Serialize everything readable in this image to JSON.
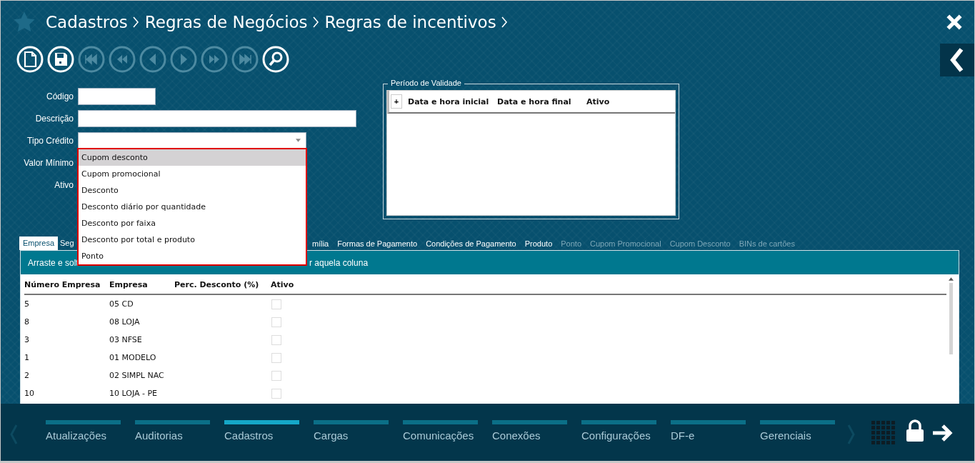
{
  "breadcrumb": [
    "Cadastros",
    "Regras de Negócios",
    "Regras de incentivos"
  ],
  "toolbar": [
    {
      "kind": "new",
      "disabled": false
    },
    {
      "kind": "save",
      "disabled": false
    },
    {
      "kind": "first",
      "disabled": true
    },
    {
      "kind": "rewind",
      "disabled": true
    },
    {
      "kind": "prev",
      "disabled": true
    },
    {
      "kind": "next",
      "disabled": true
    },
    {
      "kind": "forward",
      "disabled": true
    },
    {
      "kind": "last",
      "disabled": true
    },
    {
      "kind": "search",
      "disabled": false
    }
  ],
  "form": {
    "fields": [
      {
        "label": "Código",
        "kind": "text"
      },
      {
        "label": "Descrição",
        "kind": "text"
      },
      {
        "label": "Tipo Crédito",
        "kind": "select"
      },
      {
        "label": "Valor Mínimo",
        "kind": "covered"
      },
      {
        "label": "Ativo",
        "kind": "covered"
      }
    ]
  },
  "dropdown": {
    "options": [
      {
        "label": "Cupom desconto",
        "selected": true
      },
      {
        "label": "Cupom promocional",
        "selected": false
      },
      {
        "label": "Desconto",
        "selected": false
      },
      {
        "label": "Desconto diário por quantidade",
        "selected": false
      },
      {
        "label": "Desconto por faixa",
        "selected": false
      },
      {
        "label": "Desconto por total e produto",
        "selected": false
      },
      {
        "label": "Ponto",
        "selected": false
      }
    ]
  },
  "validity": {
    "legend": "Período de Validade",
    "add_button": "+",
    "columns": [
      "Data e hora inicial",
      "Data e hora final",
      "Ativo"
    ]
  },
  "tabs": {
    "before_dropdown": [
      {
        "label": "Empresa",
        "selected": true,
        "disabled": false
      },
      {
        "label": "Seg",
        "selected": false,
        "disabled": false
      }
    ],
    "after_dropdown": [
      {
        "label": "mília",
        "selected": false,
        "disabled": false
      },
      {
        "label": "Formas de Pagamento",
        "selected": false,
        "disabled": false
      },
      {
        "label": "Condições de Pagamento",
        "selected": false,
        "disabled": false
      },
      {
        "label": "Produto",
        "selected": false,
        "disabled": false
      },
      {
        "label": "Ponto",
        "selected": false,
        "disabled": true
      },
      {
        "label": "Cupom Promocional",
        "selected": false,
        "disabled": true
      },
      {
        "label": "Cupom Desconto",
        "selected": false,
        "disabled": true
      },
      {
        "label": "BINs de cartões",
        "selected": false,
        "disabled": true
      }
    ]
  },
  "grid": {
    "hint_before_dropdown": "Arraste e solt",
    "hint_after_dropdown": "r aquela coluna",
    "columns": [
      "Número Empresa",
      "Empresa",
      "Perc. Desconto (%)",
      "Ativo"
    ],
    "rows": [
      {
        "numero": "5",
        "empresa": "05 CD",
        "checked": false
      },
      {
        "numero": "8",
        "empresa": "08 LOJA",
        "checked": false
      },
      {
        "numero": "3",
        "empresa": "03 NFSE",
        "checked": false
      },
      {
        "numero": "1",
        "empresa": "01 MODELO",
        "checked": false
      },
      {
        "numero": "2",
        "empresa": "02 SIMPL NAC",
        "checked": false
      },
      {
        "numero": "10",
        "empresa": "10 LOJA - PE",
        "checked": false
      }
    ]
  },
  "nav": [
    {
      "label": "Atualizações",
      "selected": false
    },
    {
      "label": "Auditorias",
      "selected": false
    },
    {
      "label": "Cadastros",
      "selected": true
    },
    {
      "label": "Cargas",
      "selected": false
    },
    {
      "label": "Comunicações",
      "selected": false
    },
    {
      "label": "Conexões",
      "selected": false
    },
    {
      "label": "Configurações",
      "selected": false
    },
    {
      "label": "DF-e",
      "selected": false
    },
    {
      "label": "Gerenciais",
      "selected": false
    }
  ]
}
